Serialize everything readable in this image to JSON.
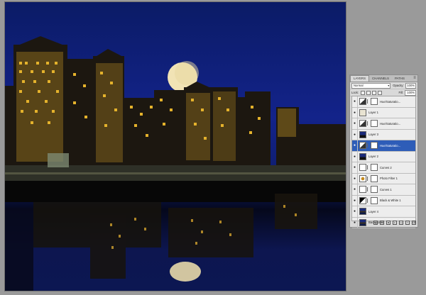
{
  "panel": {
    "tabs": [
      "LAYERS",
      "CHANNELS",
      "PATHS"
    ],
    "active_tab": "LAYERS",
    "blend_mode": "Normal",
    "opacity_label": "Opacity:",
    "opacity_value": "100%",
    "lock_label": "Lock:",
    "fill_label": "Fill:",
    "fill_value": "100%",
    "layers": [
      {
        "name": "Hue/Saturatio...",
        "thumb": "adjustment",
        "has_mask": true,
        "selected": false,
        "underline": false
      },
      {
        "name": "Layer 1",
        "thumb": "pale",
        "has_mask": false,
        "selected": false,
        "underline": true
      },
      {
        "name": "Hue/Saturatio...",
        "thumb": "adjustment",
        "has_mask": true,
        "selected": false,
        "underline": false
      },
      {
        "name": "Layer 3",
        "thumb": "photo-dark",
        "has_mask": false,
        "selected": false,
        "underline": true
      },
      {
        "name": "Hue/Saturatio...",
        "thumb": "adjustment",
        "has_mask": true,
        "selected": true,
        "underline": false
      },
      {
        "name": "Layer 2",
        "thumb": "photo-dark",
        "has_mask": false,
        "selected": false,
        "underline": true
      },
      {
        "name": "Curves 2",
        "thumb": "curves",
        "has_mask": true,
        "selected": false,
        "underline": false
      },
      {
        "name": "Photo Filter 1",
        "thumb": "photo-filter",
        "has_mask": true,
        "selected": false,
        "underline": false
      },
      {
        "name": "Curves 1",
        "thumb": "curves",
        "has_mask": true,
        "selected": false,
        "underline": false
      },
      {
        "name": "Black & White 1",
        "thumb": "bw",
        "has_mask": true,
        "selected": false,
        "underline": false
      },
      {
        "name": "Layer 4",
        "thumb": "photo",
        "has_mask": false,
        "selected": false,
        "underline": false
      },
      {
        "name": "Background",
        "thumb": "photo",
        "has_mask": false,
        "selected": false,
        "underline": false
      }
    ],
    "footer_icons": [
      "link-icon",
      "fx-icon",
      "mask-icon",
      "adjustment-icon",
      "group-icon",
      "new-layer-icon",
      "trash-icon"
    ]
  },
  "colors": {
    "sky": "#13238a",
    "moon": "#f0e2b0",
    "window_light": "#e6b52d",
    "selection": "#2e5db8"
  }
}
